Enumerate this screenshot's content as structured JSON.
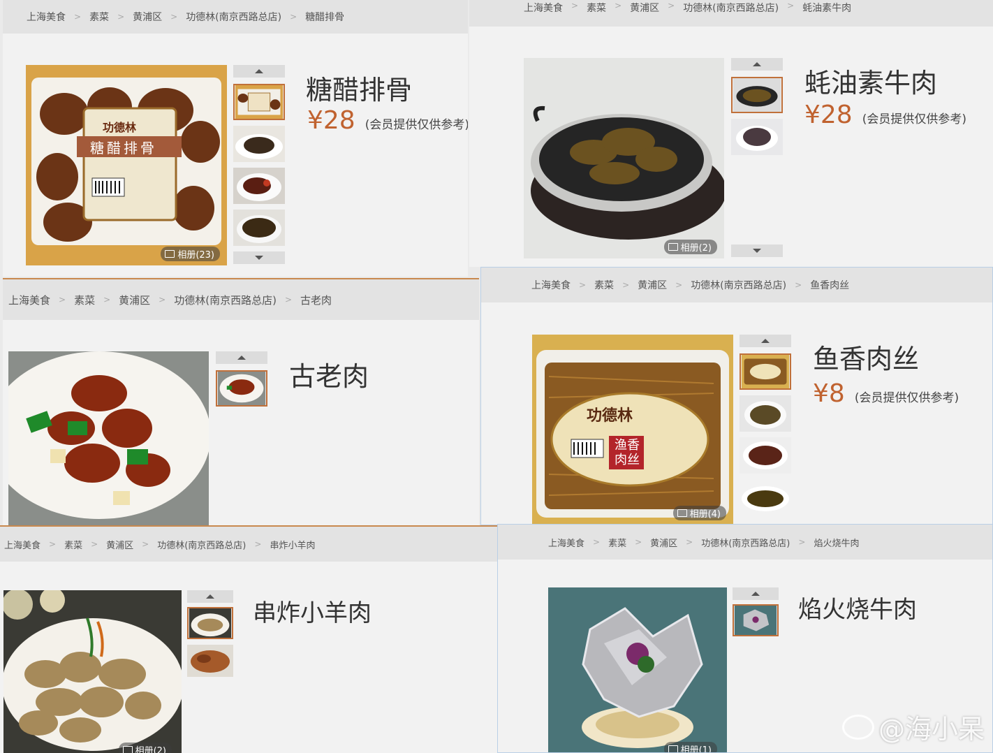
{
  "album_prefix": "相册",
  "panels": [
    {
      "crumbs": [
        "上海美食",
        "素菜",
        "黄浦区",
        "功德林(南京西路总店)",
        "糖醋排骨"
      ],
      "title": "糖醋排骨",
      "price": "¥28",
      "price_note": "(会员提供仅供参考)",
      "album": "相册(23)",
      "photo_label": "糖醋排骨",
      "brand_label": "功德林"
    },
    {
      "crumbs": [
        "上海美食",
        "素菜",
        "黄浦区",
        "功德林(南京西路总店)",
        "蚝油素牛肉"
      ],
      "title": "蚝油素牛肉",
      "price": "¥28",
      "price_note": "(会员提供仅供参考)",
      "album": "相册(2)"
    },
    {
      "crumbs": [
        "上海美食",
        "素菜",
        "黄浦区",
        "功德林(南京西路总店)",
        "古老肉"
      ],
      "title": "古老肉"
    },
    {
      "crumbs": [
        "上海美食",
        "素菜",
        "黄浦区",
        "功德林(南京西路总店)",
        "鱼香肉丝"
      ],
      "title": "鱼香肉丝",
      "price": "¥8",
      "price_note": "(会员提供仅供参考)",
      "album": "相册(4)",
      "brand_label": "功德林",
      "photo_label": "渔香肉丝"
    },
    {
      "crumbs": [
        "上海美食",
        "素菜",
        "黄浦区",
        "功德林(南京西路总店)",
        "串炸小羊肉"
      ],
      "title": "串炸小羊肉",
      "album": "相册(2)"
    },
    {
      "crumbs": [
        "上海美食",
        "素菜",
        "黄浦区",
        "功德林(南京西路总店)",
        "焰火烧牛肉"
      ],
      "title": "焰火烧牛肉",
      "album": "相册(1)"
    }
  ],
  "watermark": "@海小呆",
  "icons": [
    "picture-icon",
    "chevron-up-icon",
    "chevron-down-icon",
    "weibo-logo-icon"
  ],
  "colors": {
    "price": "#c0622f",
    "selected_border": "#c0703a",
    "breadcrumb_bg": "#e3e3e3"
  }
}
